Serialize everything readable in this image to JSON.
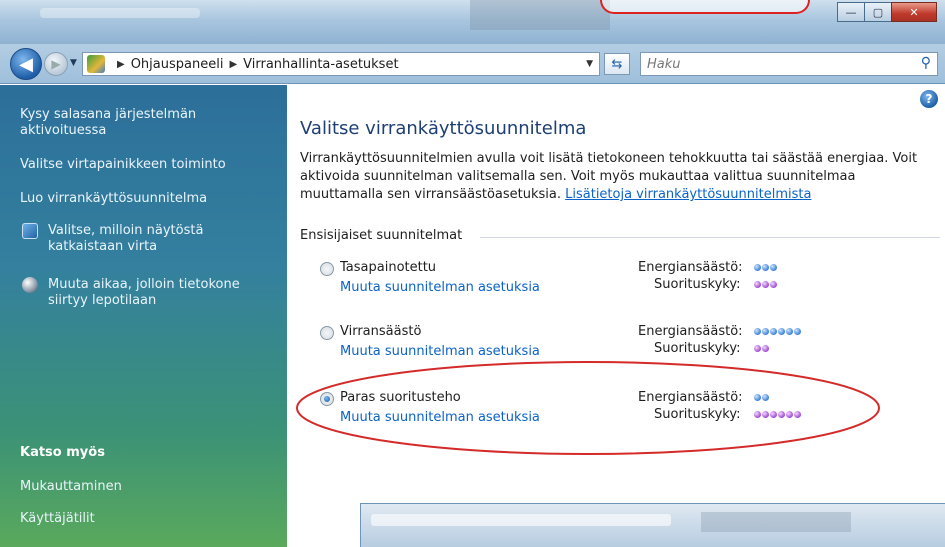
{
  "window": {
    "controls": {
      "minimize": "—",
      "maximize": "▢",
      "close": "✕"
    }
  },
  "navbar": {
    "breadcrumb": [
      "Ohjauspaneeli",
      "Virranhallinta-asetukset"
    ],
    "search_placeholder": "Haku"
  },
  "sidebar": {
    "items": [
      {
        "label": "Kysy salasana järjestelmän aktivoituessa"
      },
      {
        "label": "Valitse virtapainikkeen toiminto"
      },
      {
        "label": "Luo virrankäyttösuunnitelma"
      },
      {
        "label": "Valitse, milloin näytöstä katkaistaan virta",
        "icon": "display-icon"
      },
      {
        "label": "Muuta aikaa, jolloin tietokone siirtyy lepotilaan",
        "icon": "sleep-moon-icon"
      }
    ],
    "see_also_title": "Katso myös",
    "see_also": [
      {
        "label": "Mukauttaminen"
      },
      {
        "label": "Käyttäjätilit"
      }
    ]
  },
  "main": {
    "title": "Valitse virrankäyttösuunnitelma",
    "description": "Virrankäyttösuunnitelmien avulla voit lisätä tietokoneen tehokkuutta tai säästää energiaa. Voit aktivoida suunnitelman valitsemalla sen. Voit myös mukauttaa valittua suunnitelmaa muuttamalla sen virransäästöasetuksia.",
    "learn_more": "Lisätietoja virrankäyttösuunnitelmista",
    "group_label": "Ensisijaiset suunnitelmat",
    "energy_label": "Energiansäästö:",
    "performance_label": "Suorituskyky:",
    "plans": [
      {
        "name": "Tasapainotettu",
        "link": "Muuta suunnitelman asetuksia",
        "selected": false,
        "energy": 3,
        "performance": 3
      },
      {
        "name": "Virransäästö",
        "link": "Muuta suunnitelman asetuksia",
        "selected": false,
        "energy": 6,
        "performance": 2
      },
      {
        "name": "Paras suoritusteho",
        "link": "Muuta suunnitelman asetuksia",
        "selected": true,
        "energy": 2,
        "performance": 6
      }
    ]
  },
  "colors": {
    "annotation": "#d42a2a",
    "link": "#0b63c8",
    "title": "#1e3f73"
  }
}
